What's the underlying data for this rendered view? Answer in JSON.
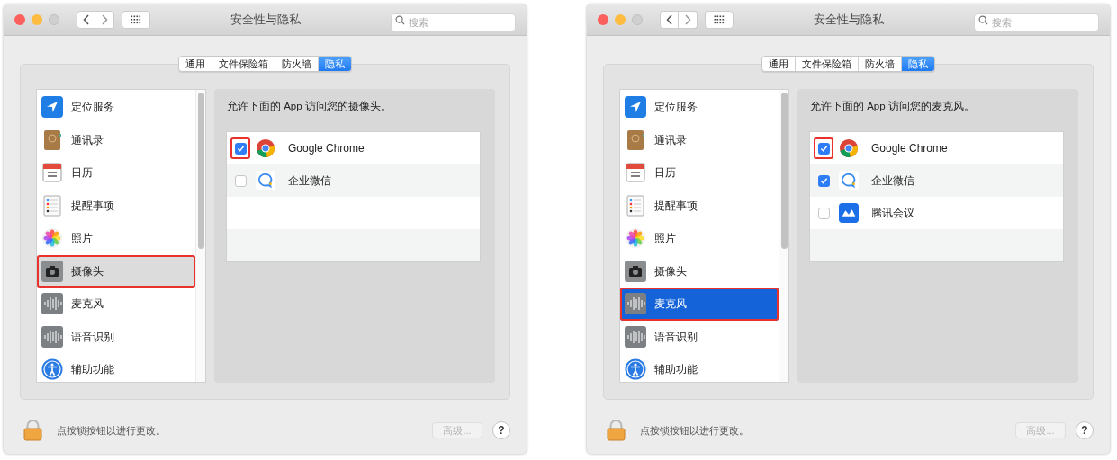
{
  "windows": [
    {
      "title": "安全性与隐私",
      "search": {
        "placeholder": "搜索"
      },
      "tabs": [
        {
          "label": "通用",
          "selected": false
        },
        {
          "label": "文件保险箱",
          "selected": false
        },
        {
          "label": "防火墙",
          "selected": false
        },
        {
          "label": "隐私",
          "selected": true
        }
      ],
      "sidebar": {
        "focused": false,
        "items": [
          {
            "label": "定位服务",
            "selected": false,
            "annotated": false
          },
          {
            "label": "通讯录",
            "selected": false,
            "annotated": false
          },
          {
            "label": "日历",
            "selected": false,
            "annotated": false
          },
          {
            "label": "提醒事项",
            "selected": false,
            "annotated": false
          },
          {
            "label": "照片",
            "selected": false,
            "annotated": false
          },
          {
            "label": "摄像头",
            "selected": true,
            "annotated": true
          },
          {
            "label": "麦克风",
            "selected": false,
            "annotated": false
          },
          {
            "label": "语音识别",
            "selected": false,
            "annotated": false
          },
          {
            "label": "辅助功能",
            "selected": false,
            "annotated": false
          }
        ]
      },
      "prompt": "允许下面的 App 访问您的摄像头。",
      "apps": [
        {
          "name": "Google Chrome",
          "kind": "chrome",
          "checked": true,
          "annotated": true
        },
        {
          "name": "企业微信",
          "kind": "chat",
          "checked": false,
          "annotated": false
        }
      ],
      "footer": {
        "lock_text": "点按锁按钮以进行更改。",
        "advanced_button": {
          "label": "高级...",
          "disabled": true
        },
        "help": "?"
      }
    },
    {
      "title": "安全性与隐私",
      "search": {
        "placeholder": "搜索"
      },
      "tabs": [
        {
          "label": "通用",
          "selected": false
        },
        {
          "label": "文件保险箱",
          "selected": false
        },
        {
          "label": "防火墙",
          "selected": false
        },
        {
          "label": "隐私",
          "selected": true
        }
      ],
      "sidebar": {
        "focused": true,
        "items": [
          {
            "label": "定位服务",
            "selected": false,
            "annotated": false
          },
          {
            "label": "通讯录",
            "selected": false,
            "annotated": false
          },
          {
            "label": "日历",
            "selected": false,
            "annotated": false
          },
          {
            "label": "提醒事项",
            "selected": false,
            "annotated": false
          },
          {
            "label": "照片",
            "selected": false,
            "annotated": false
          },
          {
            "label": "摄像头",
            "selected": false,
            "annotated": false
          },
          {
            "label": "麦克风",
            "selected": true,
            "annotated": true
          },
          {
            "label": "语音识别",
            "selected": false,
            "annotated": false
          },
          {
            "label": "辅助功能",
            "selected": false,
            "annotated": false
          }
        ]
      },
      "prompt": "允许下面的 App 访问您的麦克风。",
      "apps": [
        {
          "name": "Google Chrome",
          "kind": "chrome",
          "checked": true,
          "annotated": true
        },
        {
          "name": "企业微信",
          "kind": "chat",
          "checked": true,
          "annotated": false
        },
        {
          "name": "腾讯会议",
          "kind": "meeting",
          "checked": false,
          "annotated": false
        }
      ],
      "footer": {
        "lock_text": "点按锁按钮以进行更改。",
        "advanced_button": {
          "label": "高级...",
          "disabled": true
        },
        "help": "?"
      }
    }
  ]
}
